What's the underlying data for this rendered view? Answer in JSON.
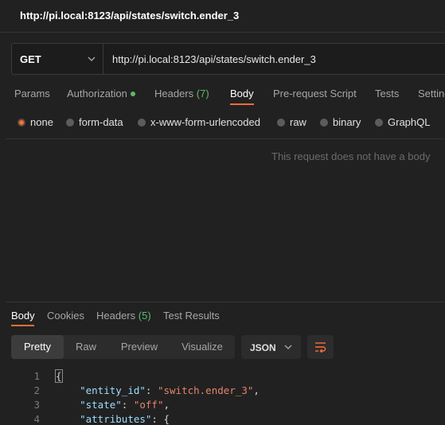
{
  "title": "http://pi.local:8123/api/states/switch.ender_3",
  "request": {
    "method": "GET",
    "url": "http://pi.local:8123/api/states/switch.ender_3"
  },
  "tabs": {
    "params": "Params",
    "authorization": "Authorization",
    "headers_label": "Headers",
    "headers_count": "(7)",
    "body": "Body",
    "pre_request": "Pre-request Script",
    "tests": "Tests",
    "settings": "Settings"
  },
  "body_types": {
    "none": "none",
    "form_data": "form-data",
    "urlencoded": "x-www-form-urlencoded",
    "raw": "raw",
    "binary": "binary",
    "graphql": "GraphQL"
  },
  "empty_message": "This request does not have a body",
  "response": {
    "tabs": {
      "body": "Body",
      "cookies": "Cookies",
      "headers_label": "Headers",
      "headers_count": "(5)",
      "test_results": "Test Results"
    },
    "views": {
      "pretty": "Pretty",
      "raw": "Raw",
      "preview": "Preview",
      "visualize": "Visualize"
    },
    "format": "JSON",
    "code": {
      "line_numbers": [
        "1",
        "2",
        "3",
        "4"
      ],
      "l1_brace": "{",
      "l2_key": "\"entity_id\"",
      "l2_value": "\"switch.ender_3\"",
      "l3_key": "\"state\"",
      "l3_value": "\"off\"",
      "l4_key": "\"attributes\"",
      "l4_brace": "{"
    }
  },
  "colors": {
    "accent": "#ff6c37",
    "status_green": "#5cba6d",
    "background": "#212121"
  }
}
